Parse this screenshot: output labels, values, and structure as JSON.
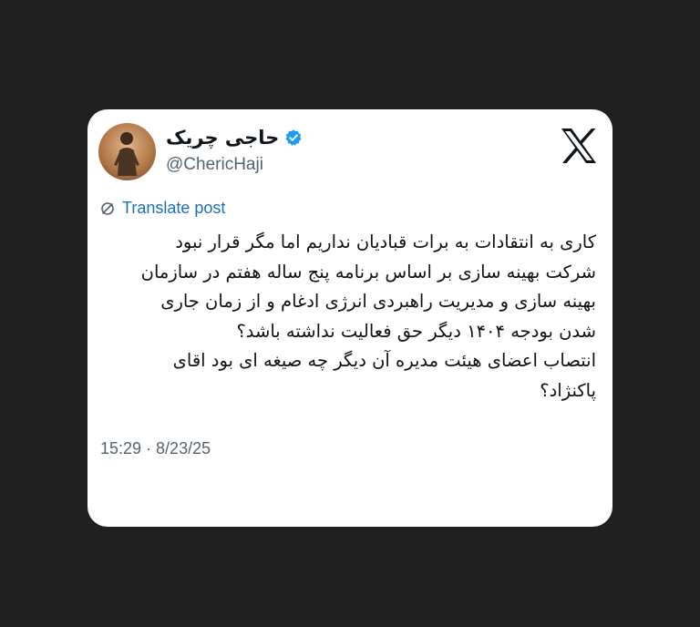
{
  "author": {
    "display_name": "حاجی چریک",
    "handle": "@ChericHaji",
    "verified": true,
    "avatar_icon": "profile-photo"
  },
  "platform": {
    "logo_icon": "x-logo"
  },
  "translate": {
    "label": "Translate post",
    "icon": "globe-slash-icon",
    "color": "#1d6fb8"
  },
  "tweet": {
    "lines": [
      "کاری به انتقادات به برات قبادیان نداریم اما مگر قرار نبود",
      "شرکت بهینه سازی بر اساس برنامه پنج ساله هفتم در سازمان",
      "بهینه سازی و مدیریت راهبردی انرژی ادغام و از زمان جاری",
      "شدن بودجه ۱۴۰۴ دیگر حق فعالیت نداشته باشد؟",
      "انتصاب اعضای هیئت مدیره آن دیگر چه صیغه ای بود اقای",
      "پاکنژاد؟"
    ],
    "timestamp": "15:29 · 8/23/25"
  },
  "colors": {
    "background": "#202020",
    "card": "#ffffff",
    "verified_badge": "#1d9bf0",
    "secondary_text": "#536471"
  }
}
